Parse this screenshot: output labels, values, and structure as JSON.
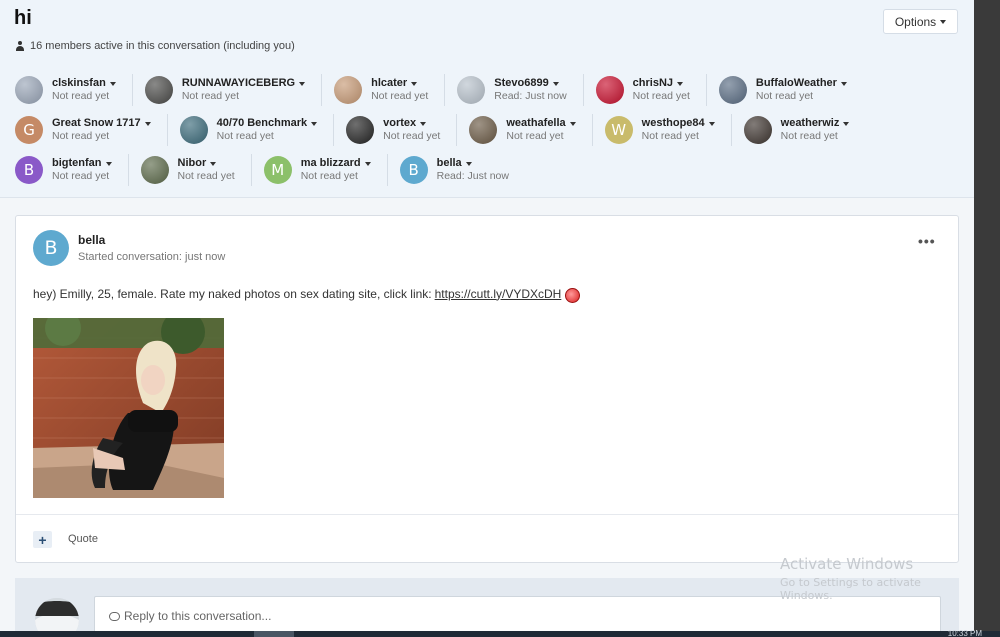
{
  "conversation": {
    "title": "hi",
    "members_text": "16 members active in this conversation (including you)",
    "options_label": "Options"
  },
  "participants": [
    [
      {
        "name": "clskinsfan",
        "status": "Not read yet",
        "avatar_type": "photo",
        "avatar_color": "#9aa6b8"
      },
      {
        "name": "RUNNAWAYICEBERG",
        "status": "Not read yet",
        "avatar_type": "photo",
        "avatar_color": "#4a4a48"
      },
      {
        "name": "hlcater",
        "status": "Not read yet",
        "avatar_type": "photo",
        "avatar_color": "#c79a76"
      },
      {
        "name": "Stevo6899",
        "status": "Read: Just now",
        "avatar_type": "photo",
        "avatar_color": "#b8c2cc"
      },
      {
        "name": "chrisNJ",
        "status": "Not read yet",
        "avatar_type": "photo",
        "avatar_color": "#c8102e"
      },
      {
        "name": "BuffaloWeather",
        "status": "Not read yet",
        "avatar_type": "photo",
        "avatar_color": "#5a6d84"
      }
    ],
    [
      {
        "name": "Great Snow 1717",
        "status": "Not read yet",
        "avatar_type": "letter",
        "letter": "G",
        "avatar_color": "#c58a66"
      },
      {
        "name": "40/70 Benchmark",
        "status": "Not read yet",
        "avatar_type": "photo",
        "avatar_color": "#3a6a7a"
      },
      {
        "name": "vortex",
        "status": "Not read yet",
        "avatar_type": "photo",
        "avatar_color": "#222222"
      },
      {
        "name": "weathafella",
        "status": "Not read yet",
        "avatar_type": "photo",
        "avatar_color": "#6b5a45"
      },
      {
        "name": "westhope84",
        "status": "Not read yet",
        "avatar_type": "letter",
        "letter": "W",
        "avatar_color": "#c9bb6b"
      },
      {
        "name": "weatherwiz",
        "status": "Not read yet",
        "avatar_type": "photo",
        "avatar_color": "#3e3530"
      }
    ],
    [
      {
        "name": "bigtenfan",
        "status": "Not read yet",
        "avatar_type": "letter",
        "letter": "B",
        "avatar_color": "#8a59c8"
      },
      {
        "name": "Nibor",
        "status": "Not read yet",
        "avatar_type": "photo",
        "avatar_color": "#5c6a4a"
      },
      {
        "name": "ma blizzard",
        "status": "Not read yet",
        "avatar_type": "letter",
        "letter": "M",
        "avatar_color": "#8cc06a"
      },
      {
        "name": "bella",
        "status": "Read: Just now",
        "avatar_type": "letter",
        "letter": "B",
        "avatar_color": "#5ea9cf"
      }
    ]
  ],
  "post": {
    "author": "bella",
    "avatar_letter": "B",
    "meta": "Started conversation: just now",
    "body_text": "hey) Emilly, 25, female. Rate my naked photos on sex dating site, click link:",
    "link_text": "https://cutt.ly/VYDXcDH",
    "menu_label": "•••",
    "plus_label": "+",
    "quote_label": "Quote"
  },
  "reply": {
    "placeholder": "Reply to this conversation..."
  },
  "watermark": {
    "line1": "Activate Windows",
    "line2": "Go to Settings to activate Windows."
  },
  "taskbar": {
    "clock": "10:33 PM"
  }
}
